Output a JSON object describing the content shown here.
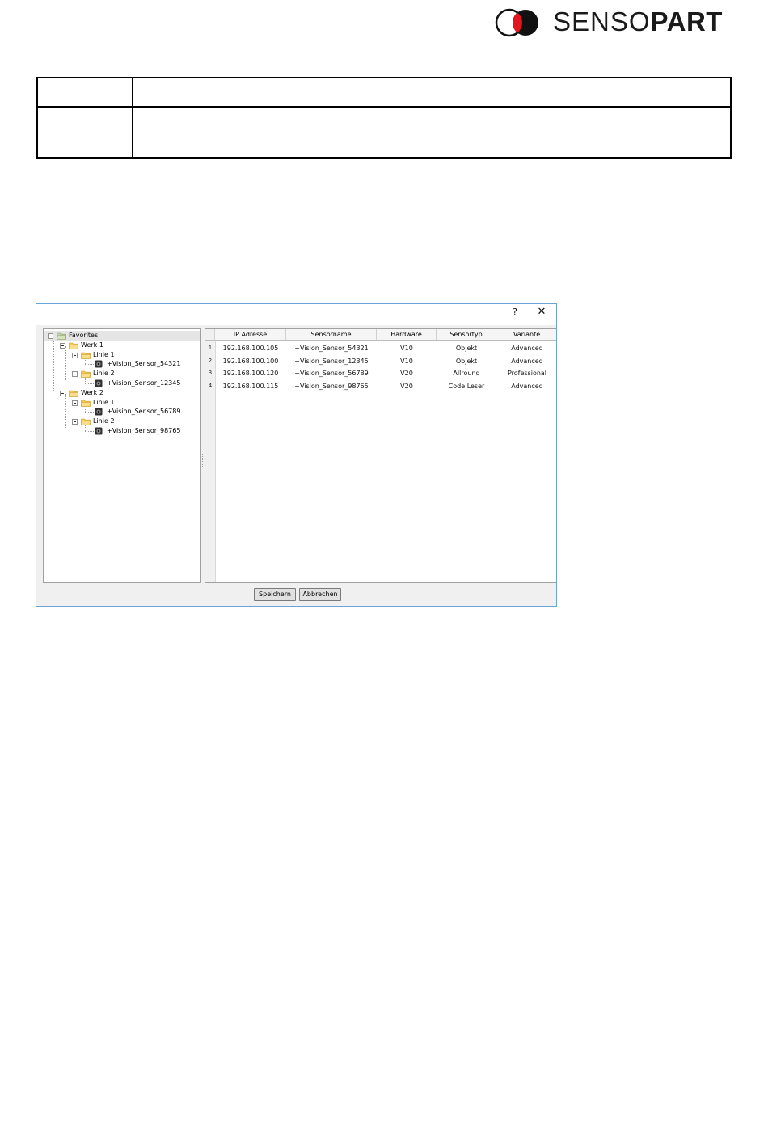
{
  "brand": {
    "logo_text_light": "SENSO",
    "logo_text_bold": "PART",
    "mark_color": "#e3161f"
  },
  "dialog": {
    "help_label": "?",
    "close_label": "✕",
    "tree": {
      "root": "Favorites",
      "nodes": [
        {
          "label": "Werk 1"
        },
        {
          "label": "Linie 1"
        },
        {
          "label": "+Vision_Sensor_54321"
        },
        {
          "label": "Linie 2"
        },
        {
          "label": "+Vision_Sensor_12345"
        },
        {
          "label": "Werk 2"
        },
        {
          "label": "Linie 1"
        },
        {
          "label": "+Vision_Sensor_56789"
        },
        {
          "label": "Linie 2"
        },
        {
          "label": "+Vision_Sensor_98765"
        }
      ]
    },
    "table": {
      "columns": [
        "IP Adresse",
        "Sensorname",
        "Hardware",
        "Sensortyp",
        "Variante"
      ],
      "rows": [
        {
          "num": "1",
          "ip": "192.168.100.105",
          "name": "+Vision_Sensor_54321",
          "hardware": "V10",
          "type": "Objekt",
          "variant": "Advanced"
        },
        {
          "num": "2",
          "ip": "192.168.100.100",
          "name": "+Vision_Sensor_12345",
          "hardware": "V10",
          "type": "Objekt",
          "variant": "Advanced"
        },
        {
          "num": "3",
          "ip": "192.168.100.120",
          "name": "+Vision_Sensor_56789",
          "hardware": "V20",
          "type": "Allround",
          "variant": "Professional"
        },
        {
          "num": "4",
          "ip": "192.168.100.115",
          "name": "+Vision_Sensor_98765",
          "hardware": "V20",
          "type": "Code Leser",
          "variant": "Advanced"
        }
      ]
    },
    "buttons": {
      "save": "Speichern",
      "cancel": "Abbrechen"
    }
  }
}
